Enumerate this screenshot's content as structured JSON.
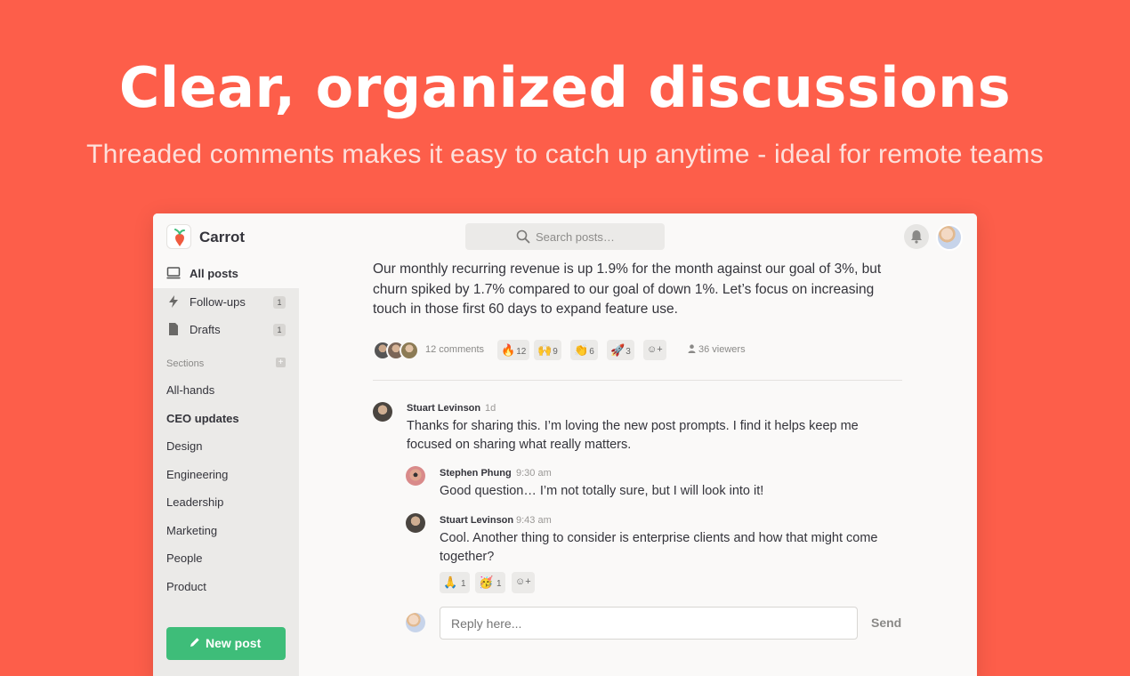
{
  "hero": {
    "title": "Clear, organized discussions",
    "subtitle": "Threaded comments makes it easy to catch up anytime - ideal for remote teams"
  },
  "colors": {
    "background": "#fd5e4a",
    "accent_green": "#3ebd79",
    "brand_orange": "#f05b3f"
  },
  "topbar": {
    "brand": "Carrot",
    "search_placeholder": "Search posts…",
    "icons": [
      "carrot-logo-icon",
      "search-icon",
      "bell-icon"
    ]
  },
  "sidebar": {
    "nav": [
      {
        "label": "All posts",
        "icon": "monitor-icon",
        "count": ""
      },
      {
        "label": "Follow-ups",
        "icon": "lightning-icon",
        "count": "1"
      },
      {
        "label": "Drafts",
        "icon": "document-icon",
        "count": "1"
      }
    ],
    "sections_label": "Sections",
    "sections": [
      "All-hands",
      "CEO updates",
      "Design",
      "Engineering",
      "Leadership",
      "Marketing",
      "People",
      "Product"
    ],
    "new_post": "New post"
  },
  "post": {
    "body": "Our monthly recurring revenue is up 1.9% for the month against our goal of 3%, but churn spiked by 1.7% compared to our goal of down 1%. Let’s focus on increasing touch in those first 60 days to expand feature use.",
    "comments_count": "12 comments",
    "reactions": [
      {
        "emoji": "🔥",
        "count": "12"
      },
      {
        "emoji": "🙌",
        "count": "9"
      },
      {
        "emoji": "👏",
        "count": "6"
      },
      {
        "emoji": "🚀",
        "count": "3"
      }
    ],
    "add_reaction": "☺+",
    "viewers": "36 viewers"
  },
  "comments": [
    {
      "author": "Stuart Levinson",
      "time": "1d",
      "text": "Thanks for sharing this. I’m loving the new post prompts. I find it helps keep me focused on sharing what really matters."
    },
    {
      "author": "Stephen Phung",
      "time": "9:30 am",
      "text": "Good question… I’m not totally sure, but I will look into it!"
    },
    {
      "author": "Stuart Levinson",
      "time": "9:43 am",
      "text": "Cool. Another thing to consider is enterprise clients and how that might come together?",
      "reactions": [
        {
          "emoji": "🙏",
          "count": "1"
        },
        {
          "emoji": "🥳",
          "count": "1"
        }
      ]
    }
  ],
  "reply": {
    "placeholder": "Reply here...",
    "send": "Send"
  }
}
